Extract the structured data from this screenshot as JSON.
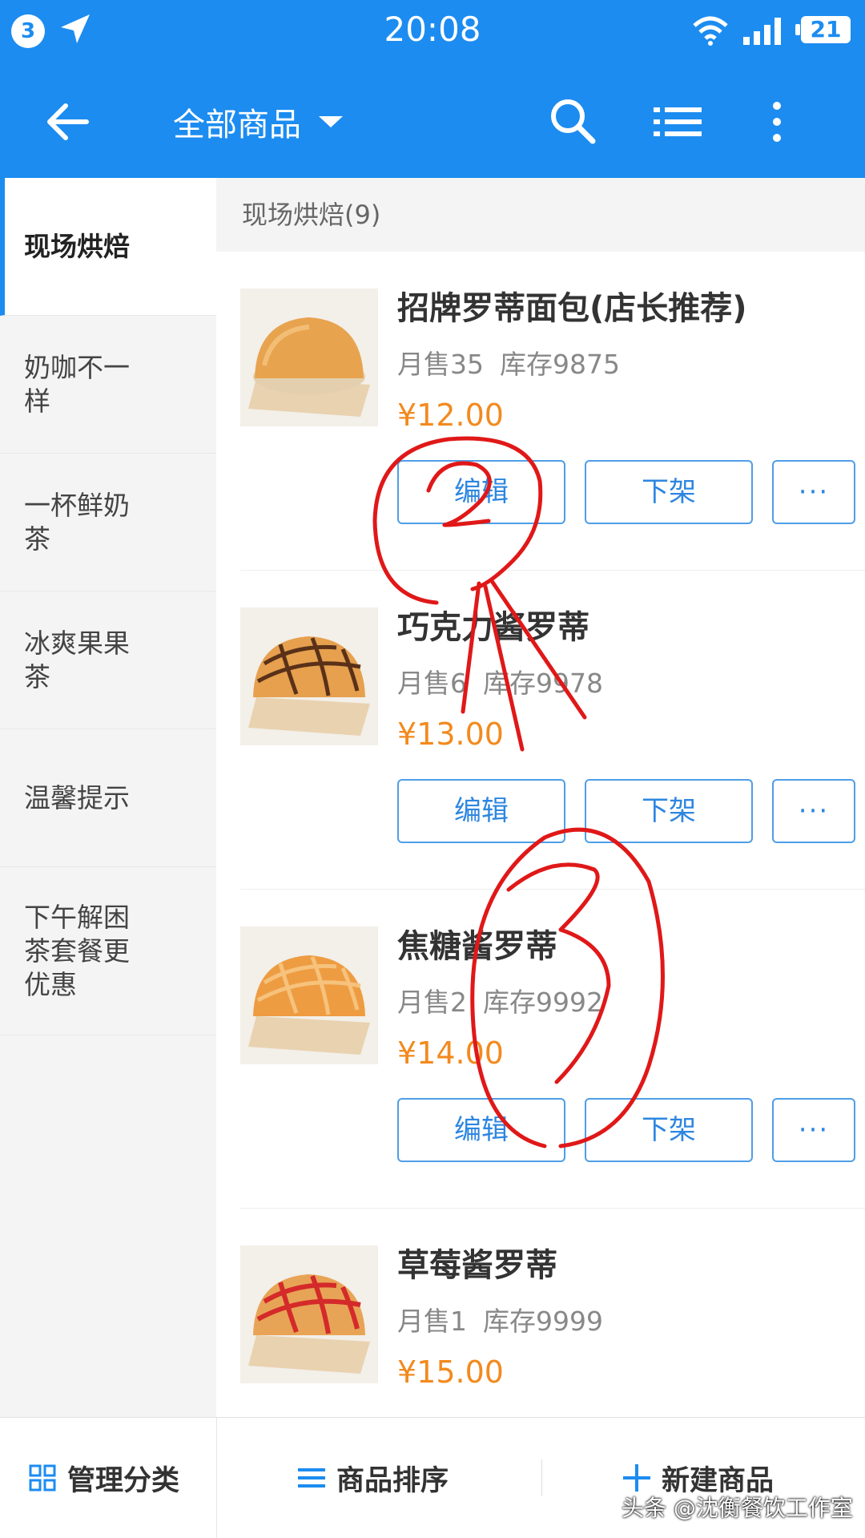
{
  "status_bar": {
    "notification_count": "3",
    "time": "20:08",
    "battery": "21"
  },
  "app_bar": {
    "title": "全部商品",
    "icons": [
      "back-arrow-icon",
      "dropdown-caret-icon",
      "search-icon",
      "list-icon",
      "more-vertical-icon"
    ]
  },
  "sidebar": {
    "items": [
      {
        "label": "现场烘焙",
        "active": true
      },
      {
        "label": "奶咖不一样",
        "active": false
      },
      {
        "label": "一杯鲜奶茶",
        "active": false
      },
      {
        "label": "冰爽果果茶",
        "active": false
      },
      {
        "label": "温馨提示",
        "active": false
      },
      {
        "label": "下午解困茶套餐更优惠",
        "active": false
      }
    ]
  },
  "section": {
    "header": "现场烘焙(9)"
  },
  "products": [
    {
      "name": "招牌罗蒂面包(店长推荐)",
      "monthly_sales": "月售35",
      "stock": "库存9875",
      "price": "¥12.00",
      "edit": "编辑",
      "off_shelf": "下架",
      "more": "···"
    },
    {
      "name": "巧克力酱罗蒂",
      "monthly_sales": "月售6",
      "stock": "库存9978",
      "price": "¥13.00",
      "edit": "编辑",
      "off_shelf": "下架",
      "more": "···"
    },
    {
      "name": "焦糖酱罗蒂",
      "monthly_sales": "月售2",
      "stock": "库存9992",
      "price": "¥14.00",
      "edit": "编辑",
      "off_shelf": "下架",
      "more": "···"
    },
    {
      "name": "草莓酱罗蒂",
      "monthly_sales": "月售1",
      "stock": "库存9999",
      "price": "¥15.00",
      "edit": "编辑",
      "off_shelf": "下架",
      "more": "···"
    }
  ],
  "bottom_bar": {
    "manage_label": "管理分类",
    "sort_label": "商品排序",
    "new_label": "新建商品"
  },
  "watermark": "头条 @沈衡餐饮工作室",
  "colors": {
    "primary": "#1c8cf0",
    "price": "#f28a1e",
    "button_text": "#2d86e0",
    "annotation": "#e01818"
  }
}
